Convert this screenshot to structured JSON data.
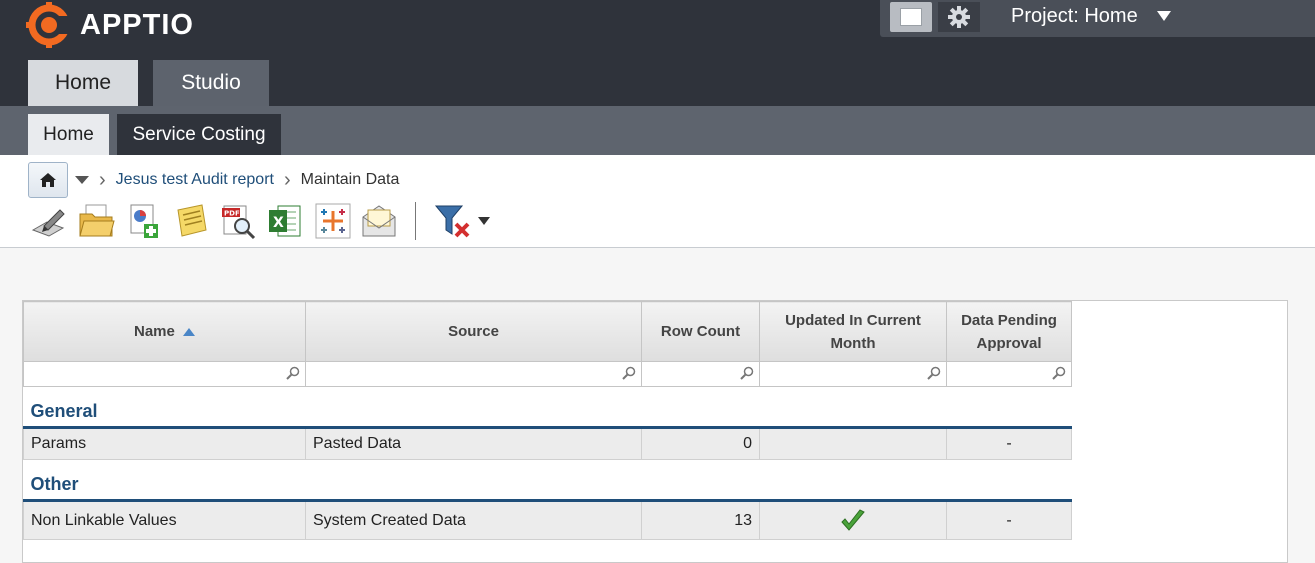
{
  "header": {
    "brand": "APPTIO",
    "project_label": "Project: Home",
    "main_tabs": [
      {
        "label": "Home",
        "active": true
      },
      {
        "label": "Studio",
        "active": false
      }
    ],
    "sub_tabs": [
      {
        "label": "Home",
        "active": true
      },
      {
        "label": "Service Costing",
        "active": false
      }
    ]
  },
  "breadcrumb": {
    "items": [
      "Jesus test Audit report",
      "Maintain Data"
    ]
  },
  "toolbar": {
    "icons": [
      "edit-icon",
      "open-folder-icon",
      "add-chart-icon",
      "notes-icon",
      "pdf-preview-icon",
      "excel-export-icon",
      "tableau-icon",
      "email-icon",
      "clear-filter-icon"
    ]
  },
  "grid": {
    "columns": [
      "Name",
      "Source",
      "Row Count",
      "Updated In Current Month",
      "Data Pending Approval"
    ],
    "sort": {
      "column": "Name",
      "direction": "ascending"
    },
    "groups": [
      {
        "name": "General",
        "rows": [
          {
            "name": "Params",
            "source": "Pasted Data",
            "row_count": "0",
            "updated": "",
            "pending": "-"
          }
        ]
      },
      {
        "name": "Other",
        "rows": [
          {
            "name": "Non Linkable Values",
            "source": "System Created Data",
            "row_count": "13",
            "updated": "check",
            "pending": "-"
          }
        ]
      }
    ]
  },
  "colors": {
    "header_bg": "#2f333b",
    "brand_orange": "#f26a21",
    "group_blue": "#1f4e79",
    "check_green": "#4aa33a"
  }
}
